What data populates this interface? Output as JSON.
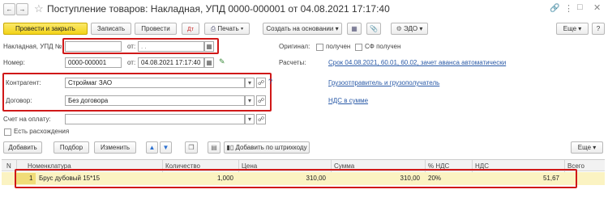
{
  "window": {
    "title": "Поступление товаров: Накладная, УПД 0000-000001 от 04.08.2021 17:17:40"
  },
  "toolbar": {
    "post_close": "Провести и закрыть",
    "save": "Записать",
    "post": "Провести",
    "print": "Печать",
    "create_based": "Создать на основании",
    "edo": "ЭДО",
    "more": "Еще"
  },
  "form": {
    "invoice_label": "Накладная, УПД №:",
    "invoice_value": "",
    "from_label": "от:",
    "invoice_date_placeholder": ". .",
    "number_label": "Номер:",
    "number_value": "0000-000001",
    "number_date": "04.08.2021 17:17:40",
    "original_label": "Оригинал:",
    "original_received": "получен",
    "sf_received": "СФ получен",
    "settlements_label": "Расчеты:",
    "settlements_link": "Срок 04.08.2021, 60.01, 60.02, зачет аванса автоматически",
    "counterparty_label": "Контрагент:",
    "counterparty_value": "Строймаг ЗАО",
    "shipper_link": "Грузоотправитель и грузополучатель",
    "contract_label": "Договор:",
    "contract_value": "Без договора",
    "vat_link": "НДС в сумме",
    "payment_label": "Счет на оплату:",
    "payment_value": "",
    "discrepancy_label": "Есть расхождения",
    "help_mark": "?"
  },
  "table_toolbar": {
    "add": "Добавить",
    "select": "Подбор",
    "change": "Изменить",
    "barcode": "Добавить по штрихкоду",
    "more": "Еще"
  },
  "table": {
    "headers": [
      "N",
      "Номенклатура",
      "Количество",
      "Цена",
      "Сумма",
      "% НДС",
      "НДС",
      "Всего"
    ],
    "rows": [
      {
        "n": "1",
        "item": "Брус дубовый 15*15",
        "qty": "1,000",
        "price": "310,00",
        "sum": "310,00",
        "vat_rate": "20%",
        "vat": "51,67",
        "total": ""
      }
    ]
  },
  "colors": {
    "primary_button": "#f3d319",
    "highlight": "#d01818",
    "row_bg": "#fbf3c2",
    "link": "#2a5aa7"
  }
}
